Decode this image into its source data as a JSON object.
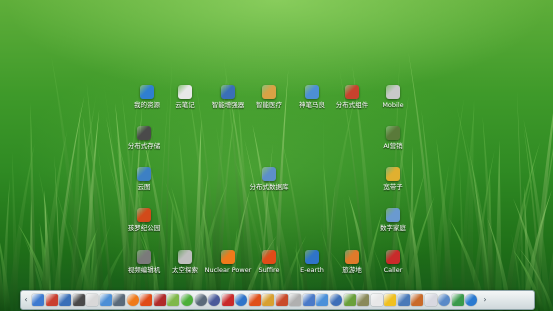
{
  "desktop": {
    "icons": [
      {
        "label": "我的资源",
        "name": "my-resources",
        "color": "#2f7fd1"
      },
      {
        "label": "云笔记",
        "name": "cloud-notes",
        "color": "#e8e8e8"
      },
      {
        "label": "智能增强器",
        "name": "smart-enhancer",
        "color": "#3a6fb8"
      },
      {
        "label": "智能医疗",
        "name": "smart-medical",
        "color": "#d9a245"
      },
      {
        "label": "神笔马良",
        "name": "magic-brush",
        "color": "#4d8fd6"
      },
      {
        "label": "分布式组件",
        "name": "distributed-components",
        "color": "#c7422e"
      },
      {
        "label": "Mobile",
        "name": "mobile",
        "color": "#c9c9c9"
      },
      {
        "label": "分布式存储",
        "name": "distributed-storage",
        "color": "#4a4a4a"
      },
      {
        "label": "AI营销",
        "name": "ai-marketing",
        "color": "#5a7a3a"
      },
      {
        "label": "云图",
        "name": "cloud-map",
        "color": "#3d80c4"
      },
      {
        "label": "分布式数据库",
        "name": "distributed-database",
        "color": "#5d8fc9"
      },
      {
        "label": "宽带子",
        "name": "broadband",
        "color": "#e0b030"
      },
      {
        "label": "孩罗纪公园",
        "name": "jurassic-park",
        "color": "#d24a1a"
      },
      {
        "label": "数字家庭",
        "name": "digital-home",
        "color": "#6a9ad0"
      },
      {
        "label": "视频编辑机",
        "name": "video-editor",
        "color": "#7a7a7a"
      },
      {
        "label": "太空探索",
        "name": "space-explore",
        "color": "#bfbfbf"
      },
      {
        "label": "Nuclear Power",
        "name": "nuclear-power",
        "color": "#f07a1a"
      },
      {
        "label": "Suffire",
        "name": "suffire",
        "color": "#e04b18"
      },
      {
        "label": "E-earth",
        "name": "e-earth",
        "color": "#2f74c9"
      },
      {
        "label": "旅游地",
        "name": "travel",
        "color": "#e07a2a"
      },
      {
        "label": "Caller",
        "name": "caller",
        "color": "#c92a2a"
      }
    ]
  },
  "taskbar": {
    "left_arrow": "‹",
    "right_arrow": "›",
    "items": [
      {
        "name": "folder-icon",
        "color": "#3d7ad0"
      },
      {
        "name": "puzzle-icon",
        "color": "#c94030"
      },
      {
        "name": "database-icon",
        "color": "#3a6fb8"
      },
      {
        "name": "terminal-icon",
        "color": "#4a4a4a"
      },
      {
        "name": "pen-icon",
        "color": "#d8d8d8"
      },
      {
        "name": "upload-icon",
        "color": "#4d8fd6"
      },
      {
        "name": "monitor-icon",
        "color": "#5a6a7a"
      },
      {
        "name": "orange-ball-icon",
        "color": "#f07a1a",
        "round": true
      },
      {
        "name": "fire-icon",
        "color": "#e04b18"
      },
      {
        "name": "bug-icon",
        "color": "#b02a2a"
      },
      {
        "name": "kiwi-icon",
        "color": "#7fb84a"
      },
      {
        "name": "green-ball-icon",
        "color": "#4caf3a",
        "round": true
      },
      {
        "name": "gear-icon",
        "color": "#5a6a7a",
        "round": true
      },
      {
        "name": "settings-icon",
        "color": "#4a5a9a",
        "round": true
      },
      {
        "name": "camera-icon",
        "color": "#c92a2a"
      },
      {
        "name": "globe-icon",
        "color": "#2f74c9",
        "round": true
      },
      {
        "name": "flame-icon",
        "color": "#e0501a"
      },
      {
        "name": "photo-icon",
        "color": "#d8a030"
      },
      {
        "name": "cubes-icon",
        "color": "#c94a2a"
      },
      {
        "name": "cabinet-icon",
        "color": "#b0b0b0"
      },
      {
        "name": "user-icon",
        "color": "#4a7ac8"
      },
      {
        "name": "chart-icon",
        "color": "#4a90d9"
      },
      {
        "name": "gear-blue-icon",
        "color": "#3d6fb8",
        "round": true
      },
      {
        "name": "leaf-icon",
        "color": "#6aa03a"
      },
      {
        "name": "tool-icon",
        "color": "#8a8a5a"
      },
      {
        "name": "sheep-icon",
        "color": "#e8e8e8"
      },
      {
        "name": "cloud-icon",
        "color": "#f0c020"
      },
      {
        "name": "books-icon",
        "color": "#4a7ab8"
      },
      {
        "name": "square-icon",
        "color": "#c96a2a"
      },
      {
        "name": "page-icon",
        "color": "#d8d8e0"
      },
      {
        "name": "swirl-icon",
        "color": "#5a8ac8",
        "round": true
      },
      {
        "name": "monitor-green-icon",
        "color": "#3a9a4a"
      },
      {
        "name": "power-icon",
        "color": "#2a7ad0",
        "round": true
      }
    ]
  }
}
